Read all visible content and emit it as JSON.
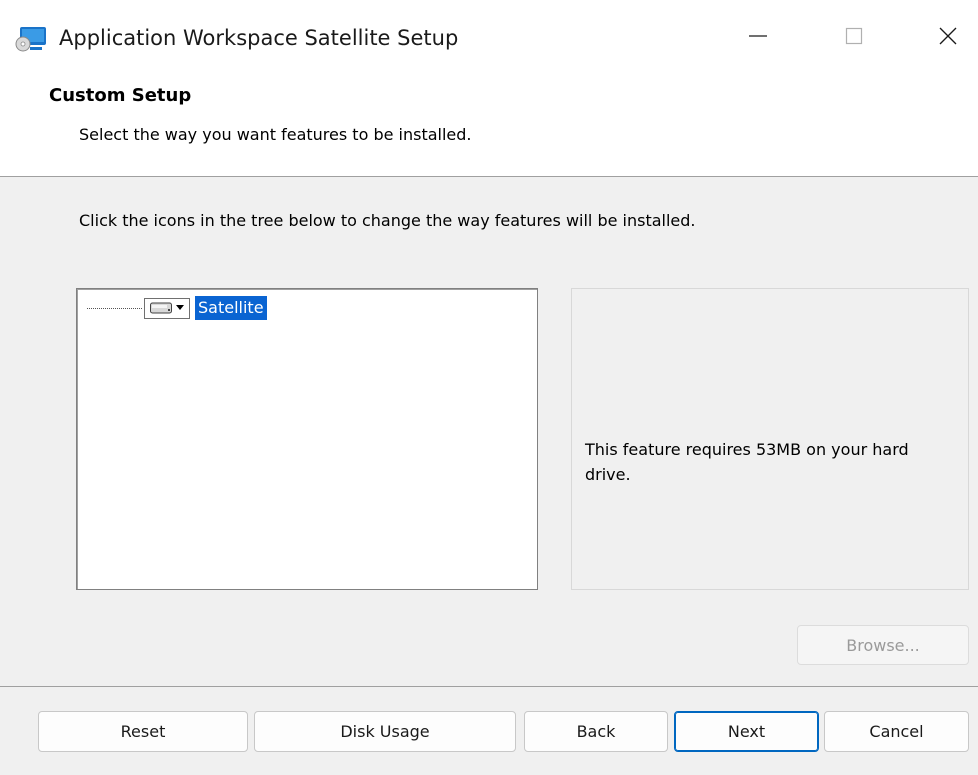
{
  "window": {
    "title": "Application Workspace Satellite Setup",
    "controls": [
      "minimize-icon",
      "maximize-icon",
      "close-icon"
    ]
  },
  "header": {
    "title": "Custom Setup",
    "subtitle": "Select the way you want features to be installed."
  },
  "instruction": "Click the icons in the tree below to change the way features will be installed.",
  "tree": {
    "items": [
      {
        "label": "Satellite",
        "icon": "hard-drive-icon",
        "selected": true
      }
    ]
  },
  "info": {
    "text": "This feature requires 53MB on your hard drive."
  },
  "buttons": {
    "browse": "Browse...",
    "reset": "Reset",
    "disk_usage": "Disk Usage",
    "back": "Back",
    "next": "Next",
    "cancel": "Cancel"
  },
  "colors": {
    "selection": "#0a64d2",
    "default_button_border": "#0067c0",
    "disabled_text": "#9a9a9a"
  }
}
